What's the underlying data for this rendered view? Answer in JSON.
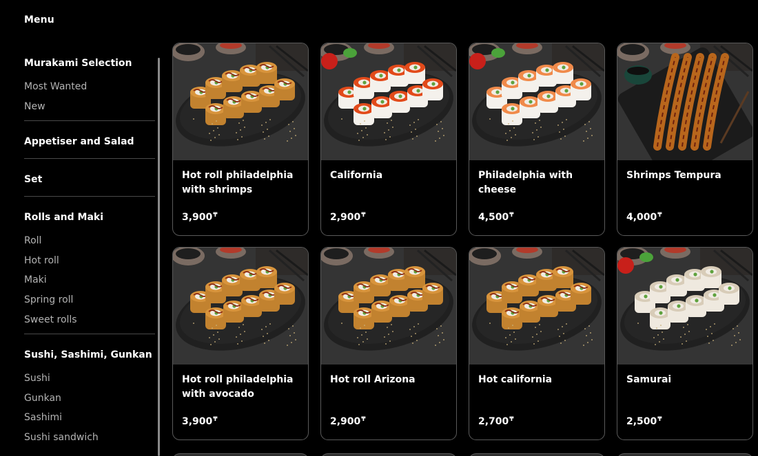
{
  "header": {
    "menu_label": "Menu"
  },
  "sidebar": {
    "sections": [
      {
        "title": "Murakami Selection",
        "items": [
          "Most Wanted",
          "New"
        ]
      },
      {
        "title": "Appetiser and Salad",
        "items": []
      },
      {
        "title": "Set",
        "items": []
      },
      {
        "title": "Rolls and Maki",
        "items": [
          "Roll",
          "Hot roll",
          "Maki",
          "Spring roll",
          "Sweet rolls"
        ]
      },
      {
        "title": "Sushi, Sashimi, Gunkan",
        "items": [
          "Sushi",
          "Gunkan",
          "Sashimi",
          "Sushi sandwich"
        ]
      }
    ]
  },
  "currency_symbol": "₸",
  "products": [
    {
      "name": "Hot roll philadelphia with shrimps",
      "price": "3,900",
      "image": "tempura-rolls-plate"
    },
    {
      "name": "California",
      "price": "2,900",
      "image": "california-rolls-plate"
    },
    {
      "name": "Philadelphia with cheese",
      "price": "4,500",
      "image": "salmon-rolls-plate"
    },
    {
      "name": "Shrimps Tempura",
      "price": "4,000",
      "image": "shrimp-tempura-plate"
    },
    {
      "name": "Hot roll philadelphia with avocado",
      "price": "3,900",
      "image": "tempura-rolls-plate"
    },
    {
      "name": "Hot roll Arizona",
      "price": "2,900",
      "image": "tempura-rolls-plate"
    },
    {
      "name": "Hot california",
      "price": "2,700",
      "image": "tempura-rolls-plate"
    },
    {
      "name": "Samurai",
      "price": "2,500",
      "image": "sesame-rolls-plate"
    }
  ]
}
